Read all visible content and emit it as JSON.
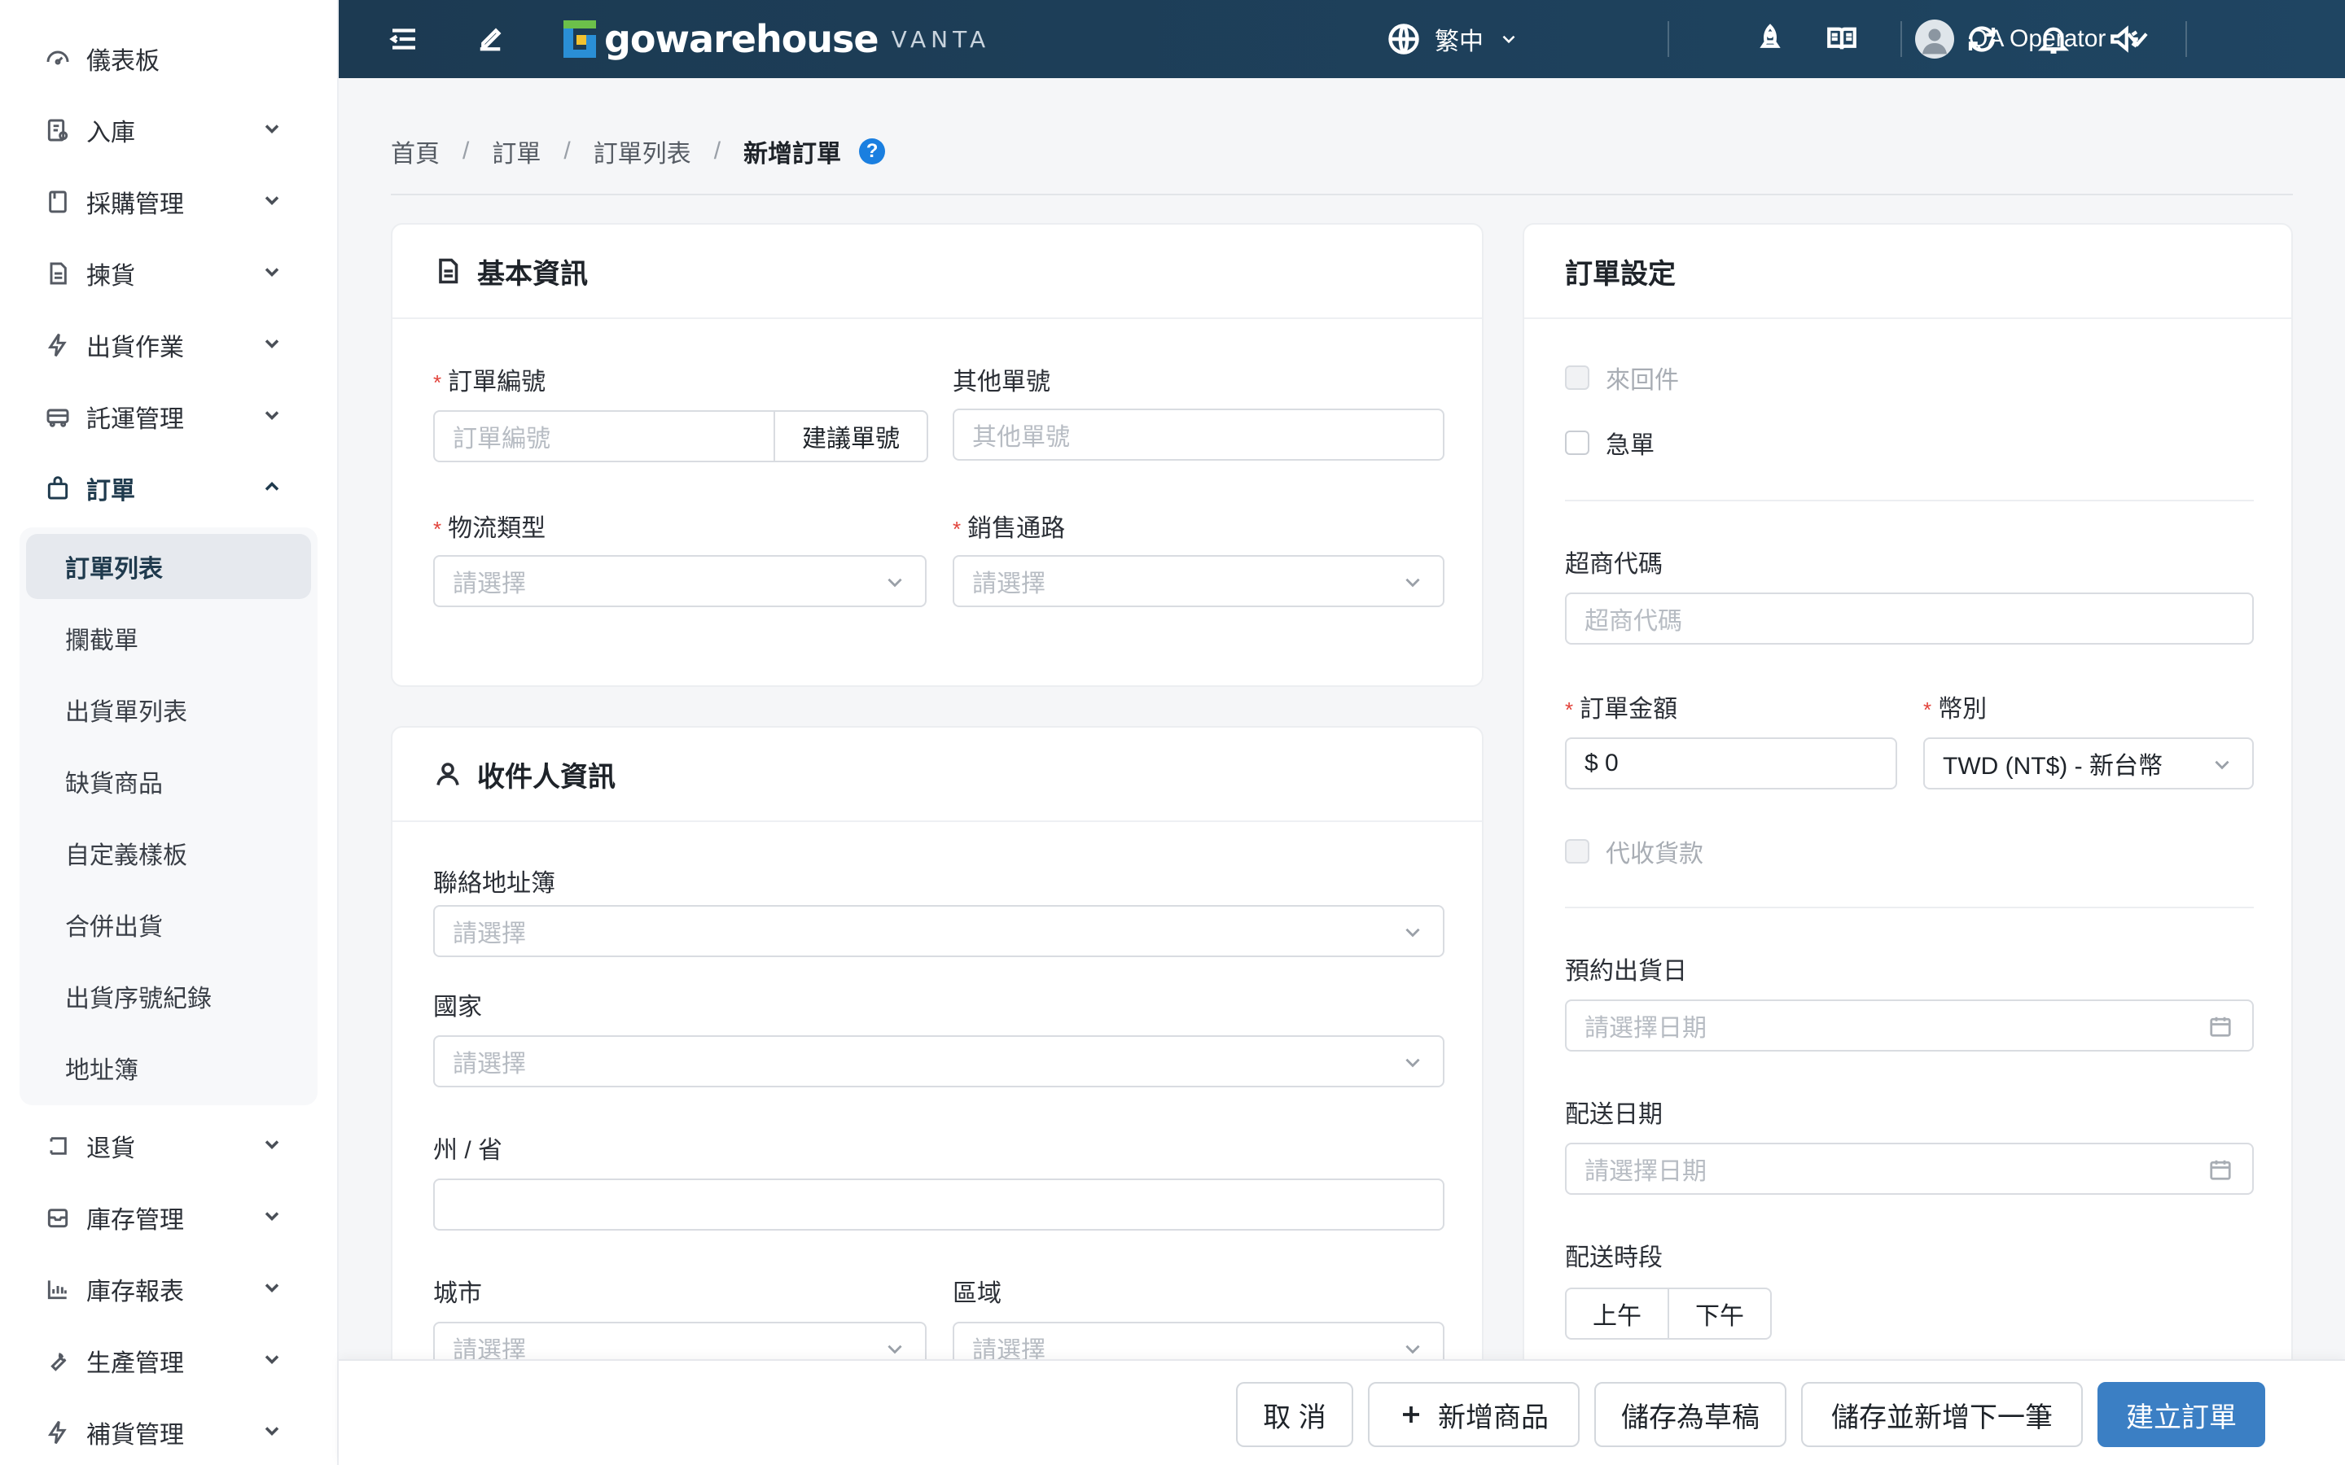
{
  "sidebar": {
    "items": [
      {
        "label": "儀表板",
        "icon": "dashboard-icon"
      },
      {
        "label": "入庫",
        "icon": "inbound-icon"
      },
      {
        "label": "採購管理",
        "icon": "purchase-icon"
      },
      {
        "label": "揀貨",
        "icon": "picking-icon"
      },
      {
        "label": "出貨作業",
        "icon": "lightning-icon"
      },
      {
        "label": "託運管理",
        "icon": "truck-icon"
      },
      {
        "label": "訂單",
        "icon": "bag-icon"
      },
      {
        "label": "退貨",
        "icon": "return-icon"
      },
      {
        "label": "庫存管理",
        "icon": "inventory-icon"
      },
      {
        "label": "庫存報表",
        "icon": "bar-chart-icon"
      },
      {
        "label": "生產管理",
        "icon": "wrench-icon"
      },
      {
        "label": "補貨管理",
        "icon": "lightning-icon"
      }
    ],
    "submenu": [
      {
        "label": "訂單列表"
      },
      {
        "label": "攔截單"
      },
      {
        "label": "出貨單列表"
      },
      {
        "label": "缺貨商品"
      },
      {
        "label": "自定義樣板"
      },
      {
        "label": "合併出貨"
      },
      {
        "label": "出貨序號紀錄"
      },
      {
        "label": "地址簿"
      }
    ]
  },
  "topbar": {
    "logo_text": "gowarehouse",
    "logo_sub": "VANTA",
    "language": "繁中",
    "user_name": "QA Operator",
    "colors": {
      "bar": "#1c3a52",
      "logo_blue": "#2a8fd6",
      "logo_yellow": "#f2c230",
      "logo_green": "#6cc04a"
    }
  },
  "breadcrumb": {
    "items": [
      "首頁",
      "訂單",
      "訂單列表"
    ],
    "current": "新增訂單",
    "help": "?"
  },
  "basic_info": {
    "title": "基本資訊",
    "order_no_label": "訂單編號",
    "order_no_placeholder": "訂單編號",
    "suggest_button": "建議單號",
    "other_no_label": "其他單號",
    "other_no_placeholder": "其他單號",
    "logistics_label": "物流類型",
    "logistics_placeholder": "請選擇",
    "channel_label": "銷售通路",
    "channel_placeholder": "請選擇"
  },
  "recipient": {
    "title": "收件人資訊",
    "address_book_label": "聯絡地址簿",
    "address_book_placeholder": "請選擇",
    "country_label": "國家",
    "country_placeholder": "請選擇",
    "state_label": "州 / 省",
    "state_value": "",
    "city_label": "城市",
    "city_placeholder": "請選擇",
    "district_label": "區域",
    "district_placeholder": "請選擇"
  },
  "order_settings": {
    "title": "訂單設定",
    "round_trip_label": "來回件",
    "urgent_label": "急單",
    "store_code_label": "超商代碼",
    "store_code_placeholder": "超商代碼",
    "amount_label": "訂單金額",
    "amount_value": "$ 0",
    "currency_label": "幣別",
    "currency_value": "TWD (NT$) - 新台幣",
    "cod_label": "代收貨款",
    "ship_date_label": "預約出貨日",
    "ship_date_placeholder": "請選擇日期",
    "delivery_date_label": "配送日期",
    "delivery_date_placeholder": "請選擇日期",
    "time_slot_label": "配送時段",
    "time_slot_am": "上午",
    "time_slot_pm": "下午"
  },
  "footer": {
    "cancel": "取 消",
    "add_product": "新增商品",
    "save_draft": "儲存為草稿",
    "save_and_new": "儲存並新增下一筆",
    "create_order": "建立訂單",
    "colors": {
      "primary": "#3b7fc4"
    }
  }
}
